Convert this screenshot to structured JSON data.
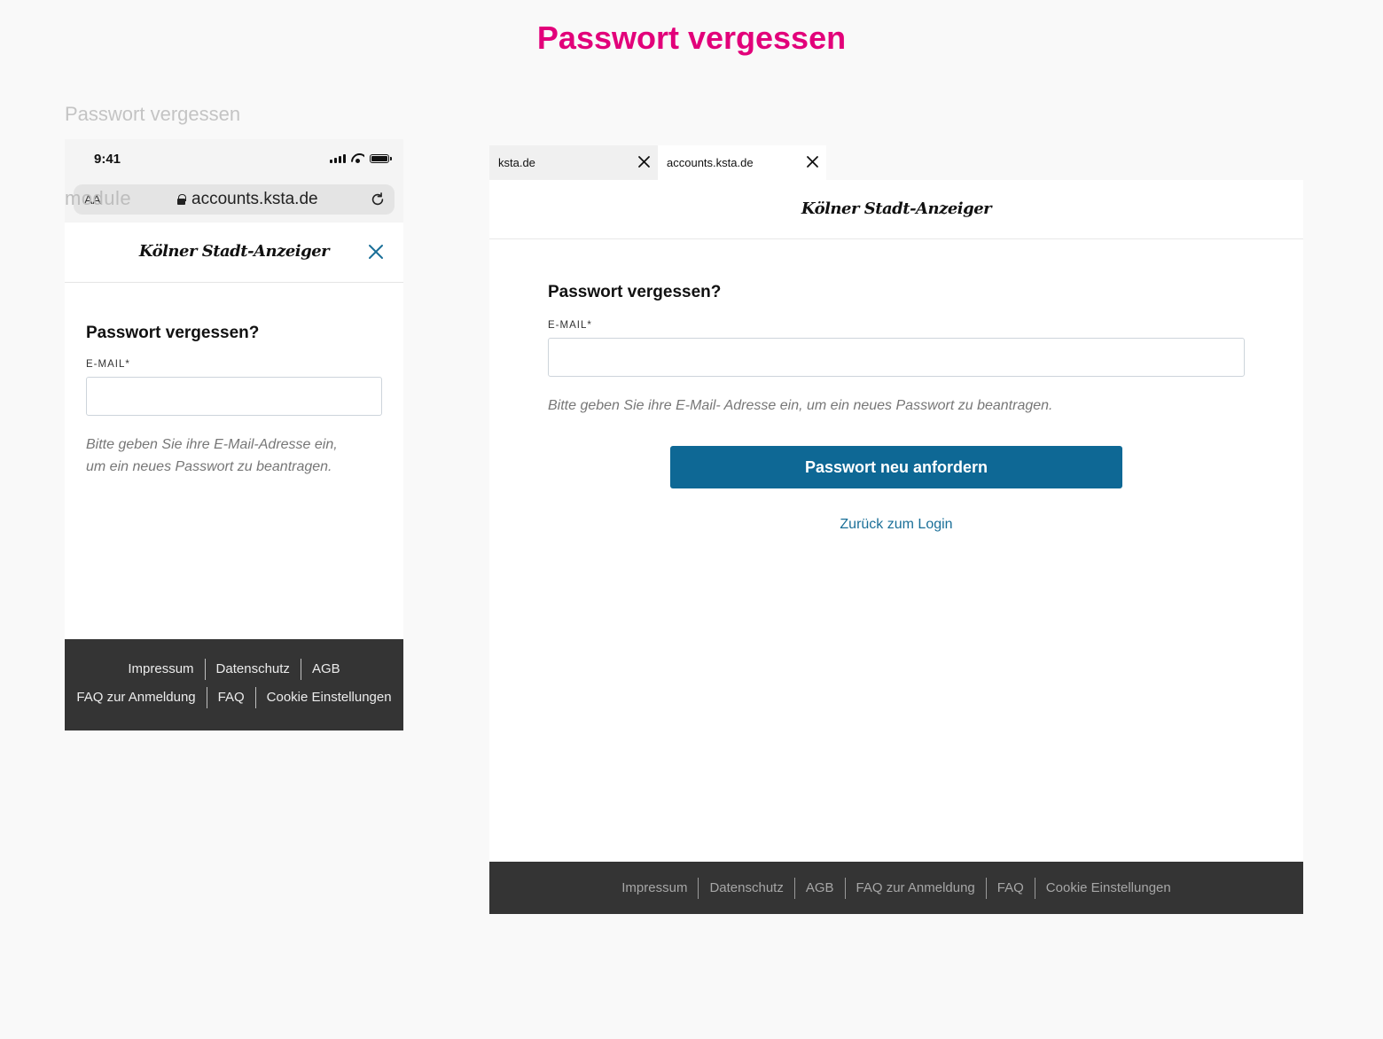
{
  "page": {
    "title": "Passwort vergessen",
    "frame_label": "Passwort vergessen",
    "accent_color": "#e2007a"
  },
  "mobile": {
    "status_bar": {
      "time": "9:41"
    },
    "url_bar": {
      "aa_label": "AA",
      "overlay_text": "module",
      "url": "accounts.ksta.de"
    },
    "header": {
      "logo_text": "Kölner Stadt-Anzeiger",
      "close_icon": "close-icon"
    },
    "form": {
      "title": "Passwort vergessen?",
      "email_label": "E-MAIL*",
      "email_value": "",
      "hint": "Bitte geben Sie ihre E-Mail-Adresse ein, um ein neues Passwort zu beantragen."
    },
    "footer": {
      "row1": [
        "Impressum",
        "Datenschutz",
        "AGB"
      ],
      "row2": [
        "FAQ zur Anmeldung",
        "FAQ",
        "Cookie Einstellungen"
      ]
    }
  },
  "desktop": {
    "tabs": [
      {
        "label": "ksta.de"
      },
      {
        "label": "accounts.ksta.de"
      }
    ],
    "header": {
      "logo_text": "Kölner Stadt-Anzeiger"
    },
    "form": {
      "title": "Passwort vergessen?",
      "email_label": "E-MAIL*",
      "email_value": "",
      "hint": "Bitte geben Sie ihre E-Mail- Adresse ein, um ein neues Passwort zu beantragen.",
      "submit_label": "Passwort neu anfordern",
      "back_link": "Zurück zum Login"
    },
    "footer": {
      "links": [
        "Impressum",
        "Datenschutz",
        "AGB",
        "FAQ zur Anmeldung",
        "FAQ",
        "Cookie Einstellungen"
      ]
    },
    "button_color": "#0e6895"
  }
}
